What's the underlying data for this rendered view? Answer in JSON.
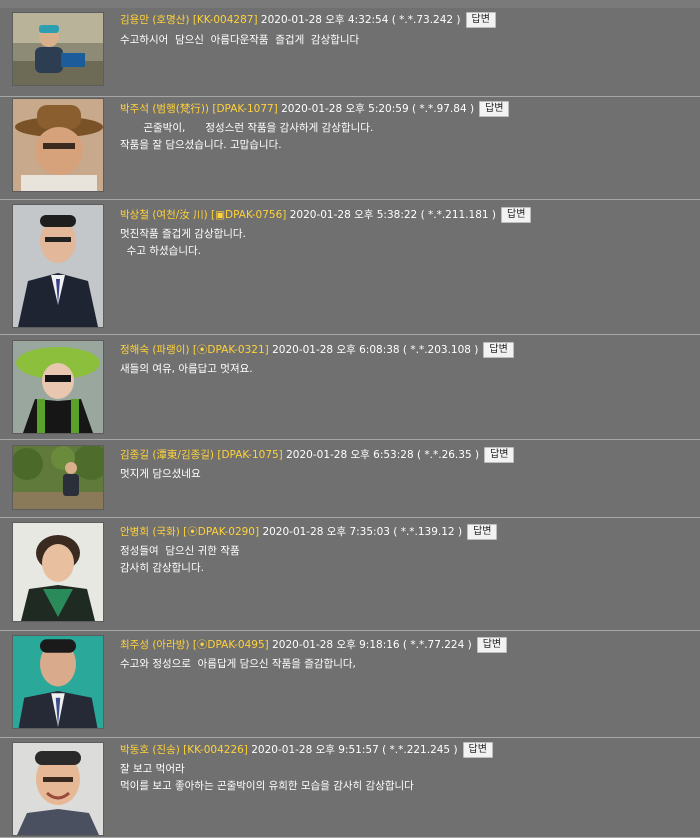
{
  "reply_label": "답변",
  "comments": [
    {
      "name": "김용만 (호명산) [KK-004287]",
      "time": "2020-01-28 오후 4:32:54 ( *.*.73.242 )",
      "lines": [
        "수고하시어  담으신  아름다운작품  즐겁게  감상합니다"
      ],
      "avatar": "teal cap cyclist"
    },
    {
      "name": "박주석 (범행(梵行)) [DPAK-1077]",
      "time": "2020-01-28 오후 5:20:59 ( *.*.97.84 )",
      "lines": [
        "       곤줄박이,      정성스런 작품을 감사하게 감상합니다.",
        "작품을 잘 담으셨습니다. 고맙습니다."
      ],
      "avatar": "brown hat man"
    },
    {
      "name": "박상철 (여천/汝 川) [▣DPAK-0756]",
      "time": "2020-01-28 오후 5:38:22 ( *.*.211.181 )",
      "lines": [
        "멋진작품 즐겁게 감상합니다.",
        "  수고 하셨습니다."
      ],
      "avatar": "man in suit"
    },
    {
      "name": "정해숙 (파랭이) [⦿DPAK-0321]",
      "time": "2020-01-28 오후 6:08:38 ( *.*.203.108 )",
      "lines": [
        "새들의 여유, 아름답고 멋져요."
      ],
      "avatar": "woman green hat"
    },
    {
      "name": "김종길 (潭東/김종길) [DPAK-1075]",
      "time": "2020-01-28 오후 6:53:28 ( *.*.26.35 )",
      "lines": [
        "멋지게 담으셨네요"
      ],
      "avatar": "person in trees"
    },
    {
      "name": "안병희 (국화) [⦿DPAK-0290]",
      "time": "2020-01-28 오후 7:35:03 ( *.*.139.12 )",
      "lines": [
        "정성들여  담으신 귀한 작품",
        "감사히 감상합니다."
      ],
      "avatar": "woman portrait"
    },
    {
      "name": "최주성 (아라방) [⦿DPAK-0495]",
      "time": "2020-01-28 오후 9:18:16 ( *.*.77.224 )",
      "lines": [
        "수고와 정성으로  아름답게 담으신 작품을 즐감합니다,"
      ],
      "avatar": "man teal background"
    },
    {
      "name": "박동호 (진송) [KK-004226]",
      "time": "2020-01-28 오후 9:51:57 ( *.*.221.245 )",
      "lines": [
        "잘 보고 먹어라",
        "먹이를 보고 좋아하는 곤줄박이의 유희한 모습을 감사히 감상합니다"
      ],
      "avatar": "smiling man"
    }
  ]
}
